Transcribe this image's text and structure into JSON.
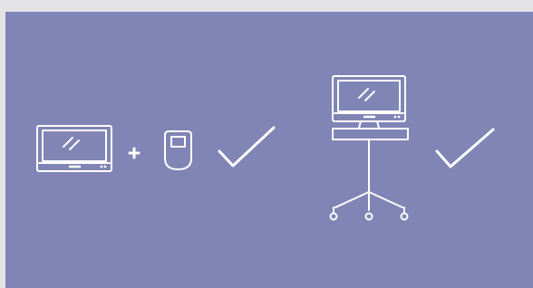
{
  "illustration": {
    "background_color": "#8185b5",
    "frame_color": "#e3e3e5",
    "line_color": "#ffffff",
    "left_group": {
      "items": [
        "monitor-icon",
        "plus-icon",
        "handheld-device-icon",
        "checkmark-icon"
      ]
    },
    "right_group": {
      "items": [
        "monitor-on-rolling-stand-icon",
        "checkmark-icon"
      ]
    }
  }
}
